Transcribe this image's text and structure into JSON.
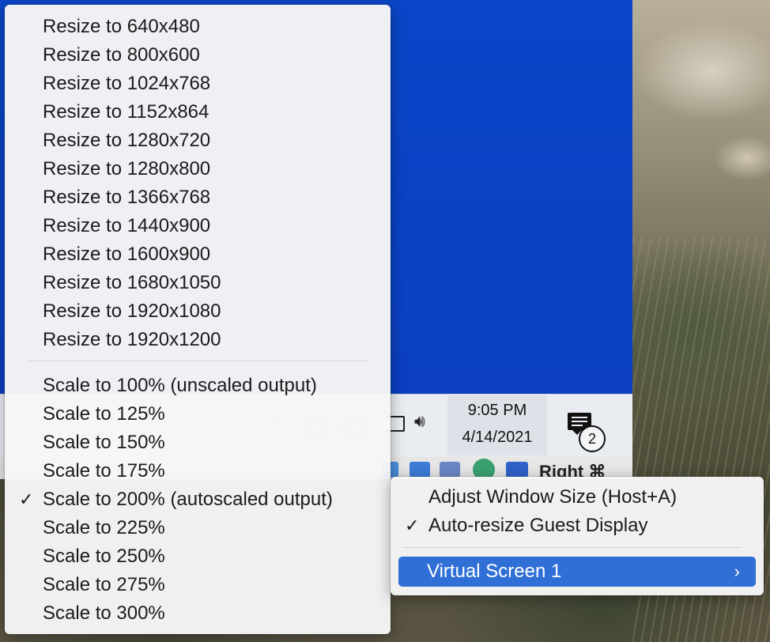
{
  "taskbar": {
    "time": "9:05 PM",
    "date": "4/14/2021",
    "notification_count": "2"
  },
  "status_bar": {
    "host_key_label": "Right ⌘"
  },
  "scale_menu": {
    "resize_items": [
      "Resize to 640x480",
      "Resize to 800x600",
      "Resize to 1024x768",
      "Resize to 1152x864",
      "Resize to 1280x720",
      "Resize to 1280x800",
      "Resize to 1366x768",
      "Resize to 1440x900",
      "Resize to 1600x900",
      "Resize to 1680x1050",
      "Resize to 1920x1080",
      "Resize to 1920x1200"
    ],
    "scale_items": [
      "Scale to 100% (unscaled output)",
      "Scale to 125%",
      "Scale to 150%",
      "Scale to 175%",
      "Scale to 200% (autoscaled output)",
      "Scale to 225%",
      "Scale to 250%",
      "Scale to 275%",
      "Scale to 300%"
    ],
    "checked_scale": "Scale to 200% (autoscaled output)",
    "check_mark": "✓"
  },
  "view_menu": {
    "adjust_window": "Adjust Window Size (Host+A)",
    "auto_resize": "Auto-resize Guest Display",
    "auto_resize_checked": true,
    "check_mark": "✓",
    "virtual_screen": "Virtual Screen 1",
    "submenu_chevron": "›"
  },
  "colors": {
    "guest_desktop": "#0b3fc0",
    "menu_highlight": "#2f6fd6"
  }
}
